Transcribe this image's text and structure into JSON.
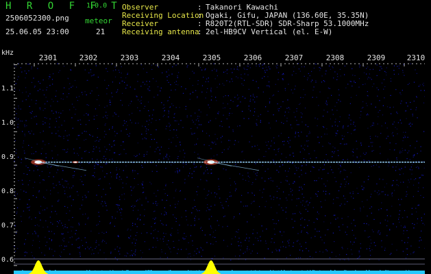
{
  "header": {
    "app_title": "H R O F F T",
    "app_version": "1.0.0",
    "file_name": "2506052300.png",
    "meteor_label": "meteor",
    "date_time": "25.06.05 23:00",
    "meteor_count": "21"
  },
  "info": [
    {
      "label": "Observer",
      "value": "Takanori Kawachi"
    },
    {
      "label": "Receiving Location",
      "value": "Ogaki, Gifu, JAPAN (136.60E, 35.35N)"
    },
    {
      "label": "Receiver",
      "value": "R820T2(RTL-SDR) SDR-Sharp 53.1000MHz"
    },
    {
      "label": "Receiving antenna",
      "value": "2el-HB9CV Vertical (el. E-W)"
    }
  ],
  "spectrogram": {
    "y_unit": "kHz",
    "y_ticks": [
      "1.1",
      "1.0",
      "0.9",
      "0.8",
      "0.7",
      "0.6"
    ],
    "x_ticks": [
      "2301",
      "2302",
      "2303",
      "2304",
      "2305",
      "2306",
      "2307",
      "2308",
      "2309",
      "2310"
    ],
    "x_range": [
      2300.5,
      2310.5
    ],
    "y_range": [
      0.575,
      1.205
    ],
    "carrier_khz": 0.909,
    "colors": {
      "background": "#000000",
      "noise": "#1a1ab4",
      "carrier": "#9bd7ff",
      "peak": "#ffffff",
      "hot": "#ff5a3c",
      "histogram_fill": "#ffff00",
      "histogram_base": "#27c8ff",
      "tick_marks": "#e6e6e6",
      "green_text": "#33d633",
      "yellow_text": "#e8e84a"
    },
    "meteor_bursts": [
      {
        "minute": 2301.1,
        "intensity": 1.0
      },
      {
        "minute": 2305.3,
        "intensity": 1.0
      },
      {
        "minute": 2302.0,
        "intensity": 0.3
      }
    ]
  }
}
